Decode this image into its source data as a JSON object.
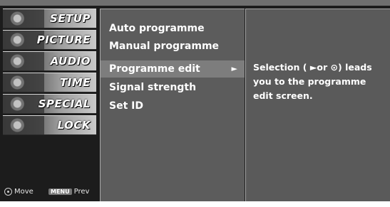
{
  "tabs": [
    {
      "label": "SETUP",
      "icon": "setup-icon"
    },
    {
      "label": "PICTURE",
      "icon": "picture-icon"
    },
    {
      "label": "AUDIO",
      "icon": "audio-icon"
    },
    {
      "label": "TIME",
      "icon": "time-icon"
    },
    {
      "label": "SPECIAL",
      "icon": "special-icon"
    },
    {
      "label": "LOCK",
      "icon": "lock-icon"
    }
  ],
  "legend": {
    "move_label": "Move",
    "prev_key": "MENU",
    "prev_label": "Prev"
  },
  "submenu": {
    "items": [
      {
        "label": "Auto programme"
      },
      {
        "label": "Manual programme"
      },
      {
        "label": "Programme edit",
        "arrow": "►"
      },
      {
        "label": "Signal strength"
      },
      {
        "label": "Set ID"
      }
    ],
    "selected_index": 2
  },
  "help": {
    "text": "Selection ( ►or ⊙) leads you to the programme edit screen."
  },
  "colors": {
    "screen_bg": "#1c1c1c",
    "panel_bg": "#5c5c5c",
    "highlight_bg": "#7d7d7d"
  }
}
